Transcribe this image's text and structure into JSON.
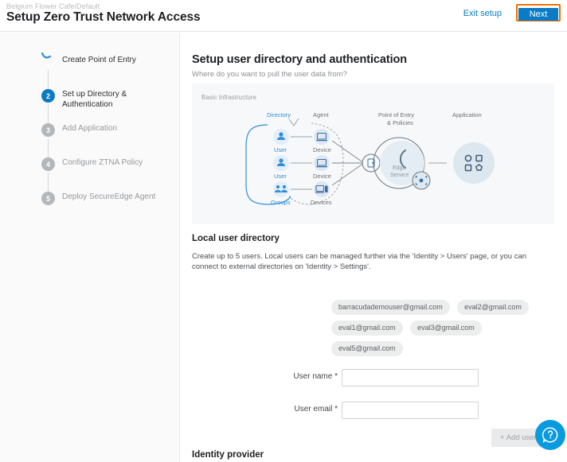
{
  "header": {
    "breadcrumb": "Belgium Flower Cafe/Default",
    "title": "Setup Zero Trust Network Access",
    "exit_label": "Exit setup",
    "next_label": "Next",
    "next_focus_color": "#f07000",
    "accent_color": "#0a7bc4"
  },
  "sidebar": {
    "steps": [
      {
        "num": "",
        "label": "Create Point of Entry",
        "state": "done"
      },
      {
        "num": "2",
        "label": "Set up Directory & Authentication",
        "state": "active"
      },
      {
        "num": "3",
        "label": "Add Application",
        "state": "todo"
      },
      {
        "num": "4",
        "label": "Configure ZTNA Policy",
        "state": "todo"
      },
      {
        "num": "5",
        "label": "Deploy SecureEdge Agent",
        "state": "todo"
      }
    ]
  },
  "main": {
    "section_title": "Setup user directory and authentication",
    "section_subtitle": "Where do you want to pull the user data from?",
    "diagram": {
      "caption": "Basic Infrastructure",
      "labels": {
        "directory": "Directory",
        "agent": "Agent",
        "point_of_entry_line1": "Point of Entry",
        "point_of_entry_line2": "& Policies",
        "application": "Application",
        "edge_line1": "Edge",
        "edge_line2": "Service"
      },
      "nodes": [
        {
          "type": "user",
          "label": "User"
        },
        {
          "type": "user",
          "label": "User"
        },
        {
          "type": "groups",
          "label": "Groups"
        },
        {
          "type": "device",
          "label": "Device"
        },
        {
          "type": "device",
          "label": "Device"
        },
        {
          "type": "devices",
          "label": "Devices"
        }
      ],
      "accent_color": "#2f8ed6",
      "panel_bg": "#f7f8f9"
    },
    "local_directory": {
      "title": "Local user directory",
      "description": "Create up to 5 users. Local users can be managed further via the 'Identity > Users' page, or you can connect to external directories on 'Identity > Settings'.",
      "user_chips": [
        "barracudademouser@gmail.com",
        "eval2@gmail.com",
        "eval1@gmail.com",
        "eval3@gmail.com",
        "eval5@gmail.com"
      ],
      "fields": [
        {
          "label": "User name *",
          "value": "",
          "placeholder": ""
        },
        {
          "label": "User email *",
          "value": "",
          "placeholder": ""
        }
      ],
      "add_user_label": "+ Add user"
    },
    "identity_provider_title": "Identity provider"
  },
  "help": {
    "icon": "question-chat-icon",
    "color": "#0a9ae0"
  }
}
